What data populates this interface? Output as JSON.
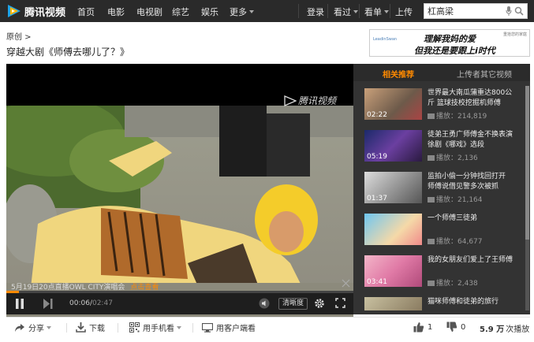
{
  "nav": {
    "logo_text": "腾讯视频",
    "links": [
      "首页",
      "电影",
      "电视剧",
      "综艺",
      "娱乐",
      "更多"
    ],
    "right_links": [
      "登录",
      "看过",
      "看单",
      "上传"
    ],
    "search_value": "杠高梁"
  },
  "page": {
    "breadcrumb": "原创 >",
    "title": "穿越大剧《师傅去哪儿了？》"
  },
  "ad": {
    "brand": "LeadinSwan",
    "line1": "理解我妈的爱",
    "line2": "但我还是要跟上i时代",
    "tag": "重拾您的家庭"
  },
  "player": {
    "watermark": "腾讯视频",
    "live_text": "5月19日20点直播OWL CITY演唱会",
    "live_link": "点击查看",
    "current_time": "00:06",
    "total_time": "02:47",
    "progress": 0.036,
    "quality": "清晰度"
  },
  "sidebar": {
    "tab_related": "相关推荐",
    "tab_uploader": "上传者其它视频",
    "items": [
      {
        "title": "世界最大南瓜蒲重达800公斤 篮球技校挖掘机师傅",
        "plays": "播放：214,819",
        "duration": "02:22"
      },
      {
        "title": "徒弟王勇广师傅金不换表演徐剧《哪戏》选段",
        "plays": "播放：2,136",
        "duration": "05:19"
      },
      {
        "title": "监拍小偷一分钟找回打开 师傅说借见警多次被抓",
        "plays": "播放：21,164",
        "duration": "01:37"
      },
      {
        "title": "一个师傅三徒弟",
        "plays": "播放：64,677",
        "duration": ""
      },
      {
        "title": "我的女朋友们爱上了王师傅",
        "plays": "播放：2,438",
        "duration": "03:41"
      },
      {
        "title": "猫咪师傅和徒弟的旅行",
        "plays": "",
        "duration": ""
      }
    ]
  },
  "bottombar": {
    "share": "分享",
    "download": "下载",
    "mobile": "用手机看",
    "client": "用客户端看",
    "likes": "1",
    "dislikes": "0",
    "views_num": "5.9 万",
    "views_label": "次播放"
  },
  "colors": {
    "accent": "#ff8a00",
    "nav_bg": "#2a2a2a",
    "sidebar_bg": "#333333"
  }
}
